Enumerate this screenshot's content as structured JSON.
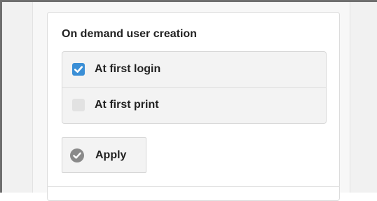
{
  "section": {
    "title": "On demand user creation",
    "options": [
      {
        "label": "At first login",
        "checked": true
      },
      {
        "label": "At first print",
        "checked": false
      }
    ],
    "apply_label": "Apply"
  },
  "colors": {
    "checkbox_checked": "#3b8fd6",
    "checkbox_unchecked": "#e2e2e2",
    "apply_icon": "#8a8a8a"
  },
  "icons": {
    "checkbox_checked": "check-icon",
    "apply": "check-circle-icon"
  }
}
